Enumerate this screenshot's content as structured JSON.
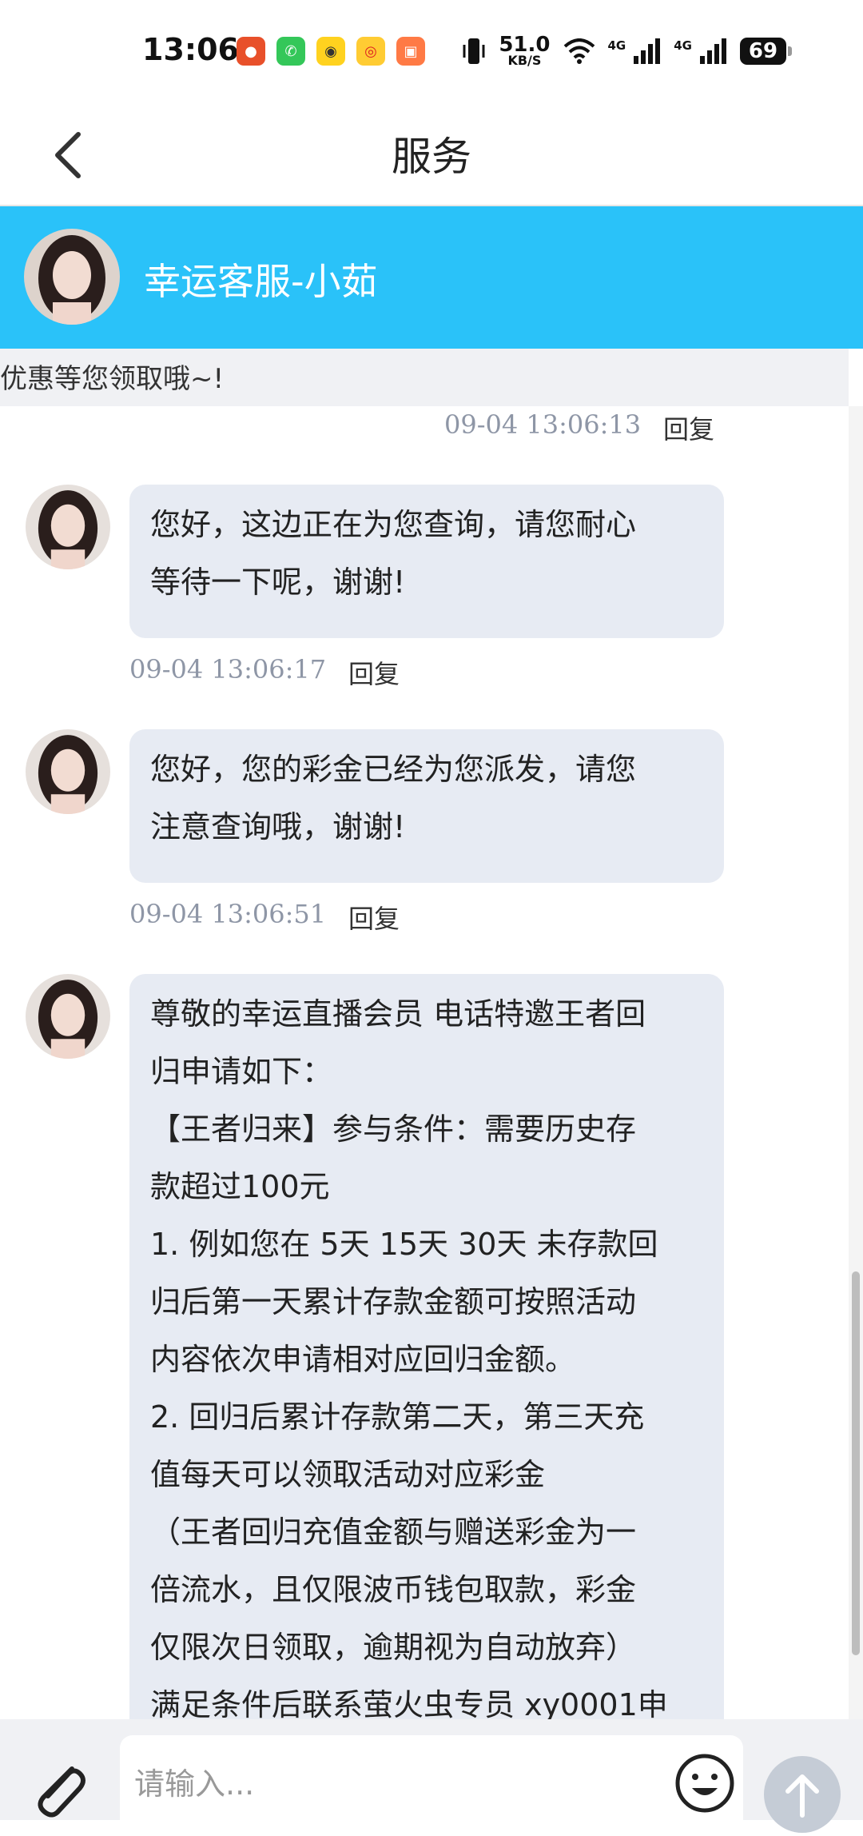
{
  "status_bar": {
    "time": "13:06",
    "net_speed_value": "51.0",
    "net_speed_unit": "KB/S",
    "signal1_label": "4G",
    "signal2_label": "4G",
    "battery": "69"
  },
  "nav": {
    "title": "服务"
  },
  "agent": {
    "name": "幸运客服-小茹"
  },
  "previous_message_tail": "优惠等您领取哦~!",
  "previous_message_meta": {
    "time": "09-04 13:06:13",
    "reply": "回复"
  },
  "messages": [
    {
      "text": "您好，这边正在为您查询，请您耐心\n等待一下呢，谢谢!",
      "time": "09-04 13:06:17",
      "reply": "回复"
    },
    {
      "text": "您好，您的彩金已经为您派发，请您\n注意查询哦，谢谢!",
      "time": "09-04 13:06:51",
      "reply": "回复"
    },
    {
      "text": "尊敬的幸运直播会员 电话特邀王者回\n归申请如下：\n【王者归来】参与条件：需要历史存\n款超过100元\n1. 例如您在 5天 15天 30天 未存款回\n归后第一天累计存款金额可按照活动\n内容依次申请相对应回归金额。\n2. 回归后累计存款第二天，第三天充\n值每天可以领取活动对应彩金\n（王者回归充值金额与赠送彩金为一\n倍流水，且仅限波币钱包取款，彩金\n仅限次日领取，逾期视为自动放弃）\n满足条件后联系萤火虫专员 xy0001申"
    }
  ],
  "input": {
    "placeholder": "请输入..."
  },
  "colors": {
    "accent": "#2ac2f9",
    "bubble": "#e7ebf3",
    "meta": "#8e96a6"
  }
}
